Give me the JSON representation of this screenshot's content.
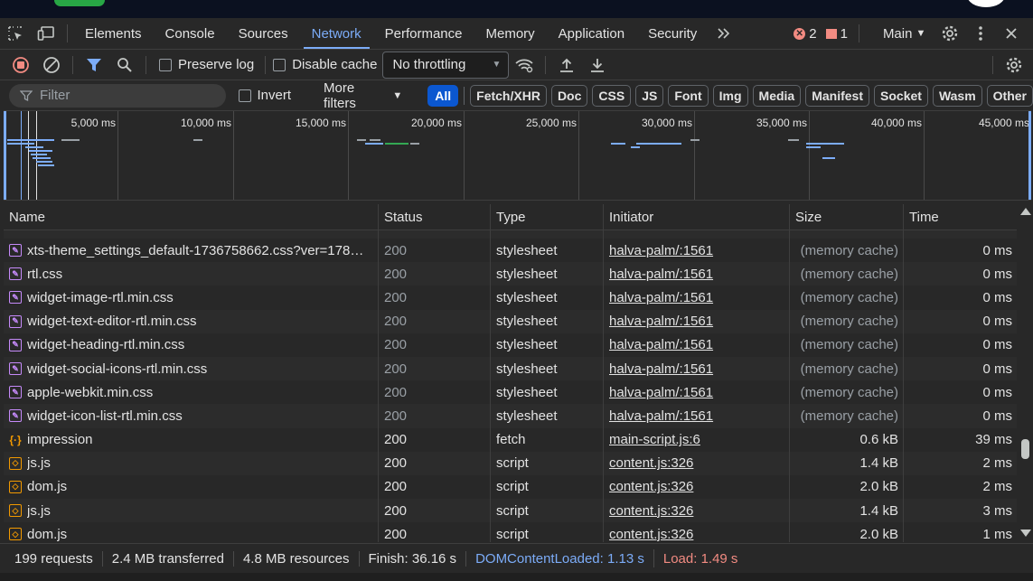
{
  "tabs": [
    {
      "label": "Elements"
    },
    {
      "label": "Console"
    },
    {
      "label": "Sources"
    },
    {
      "label": "Network",
      "active": true
    },
    {
      "label": "Performance"
    },
    {
      "label": "Memory"
    },
    {
      "label": "Application"
    },
    {
      "label": "Security"
    }
  ],
  "issues": {
    "errors": "2",
    "warnings": "1"
  },
  "context": {
    "label": "Main"
  },
  "toolbar": {
    "preserve_log_label": "Preserve log",
    "disable_cache_label": "Disable cache",
    "throttling_value": "No throttling"
  },
  "filterbar": {
    "filter_placeholder": "Filter",
    "invert_label": "Invert",
    "more_filters_label": "More filters",
    "types": [
      "All",
      "Fetch/XHR",
      "Doc",
      "CSS",
      "JS",
      "Font",
      "Img",
      "Media",
      "Manifest",
      "Socket",
      "Wasm",
      "Other"
    ],
    "active_type": "All"
  },
  "overview": {
    "tick_labels": [
      "5,000 ms",
      "10,000 ms",
      "15,000 ms",
      "20,000 ms",
      "25,000 ms",
      "30,000 ms",
      "35,000 ms",
      "40,000 ms",
      "45,000 ms"
    ]
  },
  "columns": [
    "Name",
    "Status",
    "Type",
    "Initiator",
    "Size",
    "Time"
  ],
  "rows": [
    {
      "name": "xts-theme_settings_default-1736758662.css?ver=17853...",
      "status": "200",
      "type": "stylesheet",
      "initiator": "halva-palm/:1561",
      "size": "(memory cache)",
      "time": "0 ms",
      "icon": "css-file-icon",
      "cached": true
    },
    {
      "name": "rtl.css",
      "status": "200",
      "type": "stylesheet",
      "initiator": "halva-palm/:1561",
      "size": "(memory cache)",
      "time": "0 ms",
      "icon": "css-file-icon",
      "cached": true
    },
    {
      "name": "widget-image-rtl.min.css",
      "status": "200",
      "type": "stylesheet",
      "initiator": "halva-palm/:1561",
      "size": "(memory cache)",
      "time": "0 ms",
      "icon": "css-file-icon",
      "cached": true
    },
    {
      "name": "widget-text-editor-rtl.min.css",
      "status": "200",
      "type": "stylesheet",
      "initiator": "halva-palm/:1561",
      "size": "(memory cache)",
      "time": "0 ms",
      "icon": "css-file-icon",
      "cached": true
    },
    {
      "name": "widget-heading-rtl.min.css",
      "status": "200",
      "type": "stylesheet",
      "initiator": "halva-palm/:1561",
      "size": "(memory cache)",
      "time": "0 ms",
      "icon": "css-file-icon",
      "cached": true
    },
    {
      "name": "widget-social-icons-rtl.min.css",
      "status": "200",
      "type": "stylesheet",
      "initiator": "halva-palm/:1561",
      "size": "(memory cache)",
      "time": "0 ms",
      "icon": "css-file-icon",
      "cached": true
    },
    {
      "name": "apple-webkit.min.css",
      "status": "200",
      "type": "stylesheet",
      "initiator": "halva-palm/:1561",
      "size": "(memory cache)",
      "time": "0 ms",
      "icon": "css-file-icon",
      "cached": true
    },
    {
      "name": "widget-icon-list-rtl.min.css",
      "status": "200",
      "type": "stylesheet",
      "initiator": "halva-palm/:1561",
      "size": "(memory cache)",
      "time": "0 ms",
      "icon": "css-file-icon",
      "cached": true
    },
    {
      "name": "impression",
      "status": "200",
      "type": "fetch",
      "initiator": "main-script.js:6",
      "size": "0.6 kB",
      "time": "39 ms",
      "icon": "fetch-icon",
      "cached": false
    },
    {
      "name": "js.js",
      "status": "200",
      "type": "script",
      "initiator": "content.js:326",
      "size": "1.4 kB",
      "time": "2 ms",
      "icon": "script-file-icon",
      "cached": false
    },
    {
      "name": "dom.js",
      "status": "200",
      "type": "script",
      "initiator": "content.js:326",
      "size": "2.0 kB",
      "time": "2 ms",
      "icon": "script-file-icon",
      "cached": false
    },
    {
      "name": "js.js",
      "status": "200",
      "type": "script",
      "initiator": "content.js:326",
      "size": "1.4 kB",
      "time": "3 ms",
      "icon": "script-file-icon",
      "cached": false
    },
    {
      "name": "dom.js",
      "status": "200",
      "type": "script",
      "initiator": "content.js:326",
      "size": "2.0 kB",
      "time": "1 ms",
      "icon": "script-file-icon",
      "cached": false
    }
  ],
  "summary": {
    "requests": "199 requests",
    "transferred": "2.4 MB transferred",
    "resources": "4.8 MB resources",
    "finish": "Finish: 36.16 s",
    "dcl": "DOMContentLoaded: 1.13 s",
    "load": "Load: 1.49 s"
  },
  "colors": {
    "accent": "#7cacf8",
    "error": "#f28b82",
    "chip_active": "#0b57d0"
  }
}
